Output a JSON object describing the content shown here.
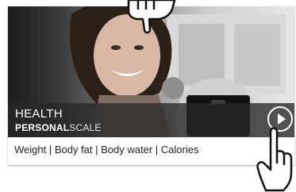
{
  "product": {
    "title_line1": "HEALTH",
    "title_bold": "PERSONAL",
    "title_light": "SCALE",
    "features": "Weight | Body fat | Body water | Calories"
  },
  "icons": {
    "play": "play-circle-icon",
    "top_hand": "tap-hand-icon",
    "bottom_hand": "tap-hand-icon"
  },
  "colors": {
    "caption_band": "#282828",
    "text_dark": "#222222",
    "text_light": "#ffffff"
  }
}
